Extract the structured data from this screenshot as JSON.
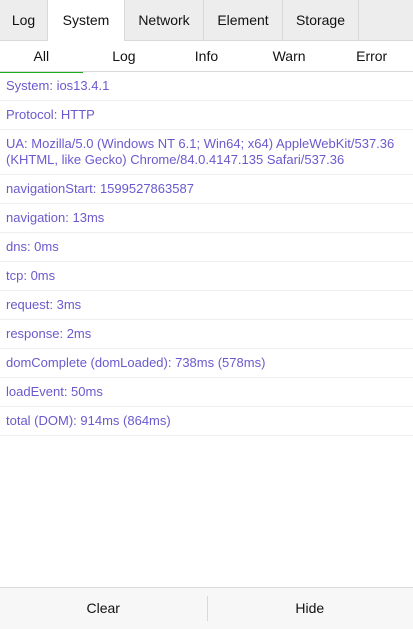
{
  "tabs": [
    {
      "label": "Log"
    },
    {
      "label": "System"
    },
    {
      "label": "Network"
    },
    {
      "label": "Element"
    },
    {
      "label": "Storage"
    }
  ],
  "active_tab": "System",
  "subtabs": [
    {
      "label": "All"
    },
    {
      "label": "Log"
    },
    {
      "label": "Info"
    },
    {
      "label": "Warn"
    },
    {
      "label": "Error"
    }
  ],
  "active_subtab": "All",
  "rows": [
    {
      "text": "System: ios13.4.1"
    },
    {
      "text": "Protocol: HTTP"
    },
    {
      "text": "UA: Mozilla/5.0 (Windows NT 6.1; Win64; x64) AppleWebKit/537.36 (KHTML, like Gecko) Chrome/84.0.4147.135 Safari/537.36"
    },
    {
      "text": "navigationStart: 1599527863587"
    },
    {
      "text": "navigation: 13ms"
    },
    {
      "text": "dns: 0ms"
    },
    {
      "text": "tcp: 0ms"
    },
    {
      "text": "request: 3ms"
    },
    {
      "text": "response: 2ms"
    },
    {
      "text": "domComplete (domLoaded): 738ms (578ms)"
    },
    {
      "text": "loadEvent: 50ms"
    },
    {
      "text": "total (DOM): 914ms (864ms)"
    }
  ],
  "footer": {
    "clear_label": "Clear",
    "hide_label": "Hide"
  },
  "colors": {
    "log_text": "#6a5acd",
    "accent": "#1aad19"
  }
}
